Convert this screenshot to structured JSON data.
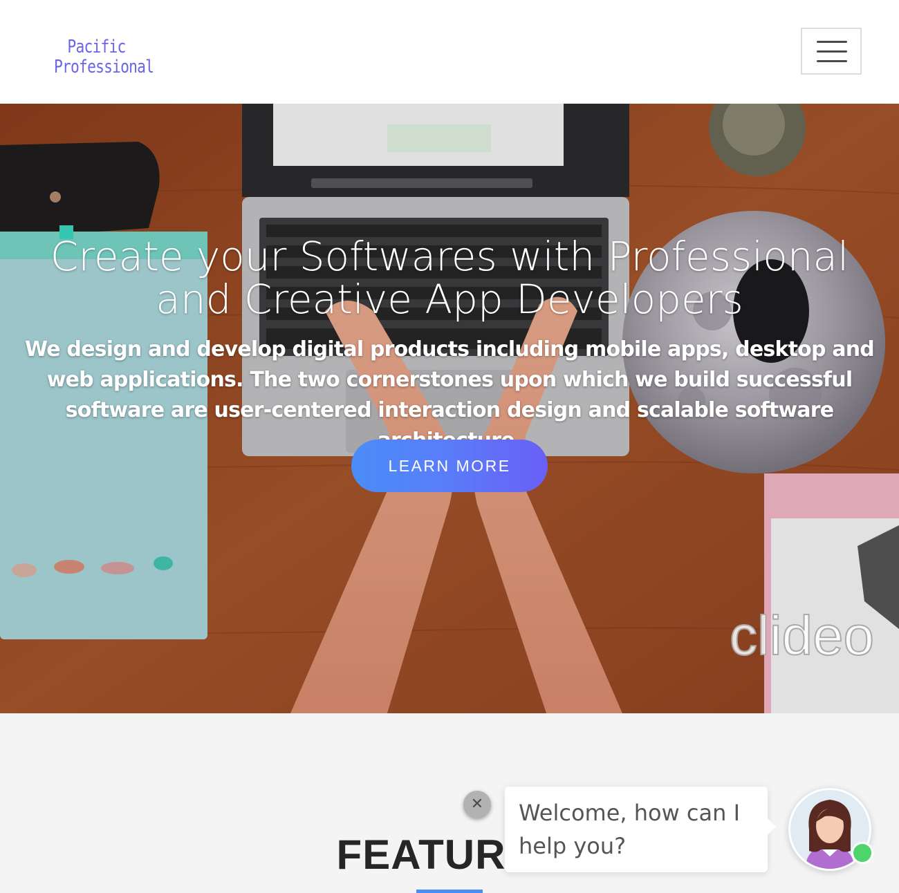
{
  "header": {
    "logo_line1": "Pacific",
    "logo_line2": "Professional",
    "menu_icon": "hamburger-menu-icon"
  },
  "hero": {
    "title": "Create your Softwares with Professional and Creative App Developers",
    "subtitle": "We design and develop digital products including mobile apps, desktop and web applications. The two cornerstones upon which we build successful software are user-centered interaction design and scalable software architecture.",
    "button_label": "LEARN MORE",
    "watermark": "clideo"
  },
  "features": {
    "title": "FEATURES"
  },
  "chat": {
    "close_icon": "close-icon",
    "welcome_message": "Welcome, how can I help you?",
    "avatar_icon": "agent-avatar-icon",
    "status": "online"
  },
  "colors": {
    "brand": "#6b63e8",
    "button_gradient_start": "#4a8df8",
    "button_gradient_end": "#6a5ff5",
    "online": "#4fd36b",
    "accent_underline": "#4a8df8"
  }
}
